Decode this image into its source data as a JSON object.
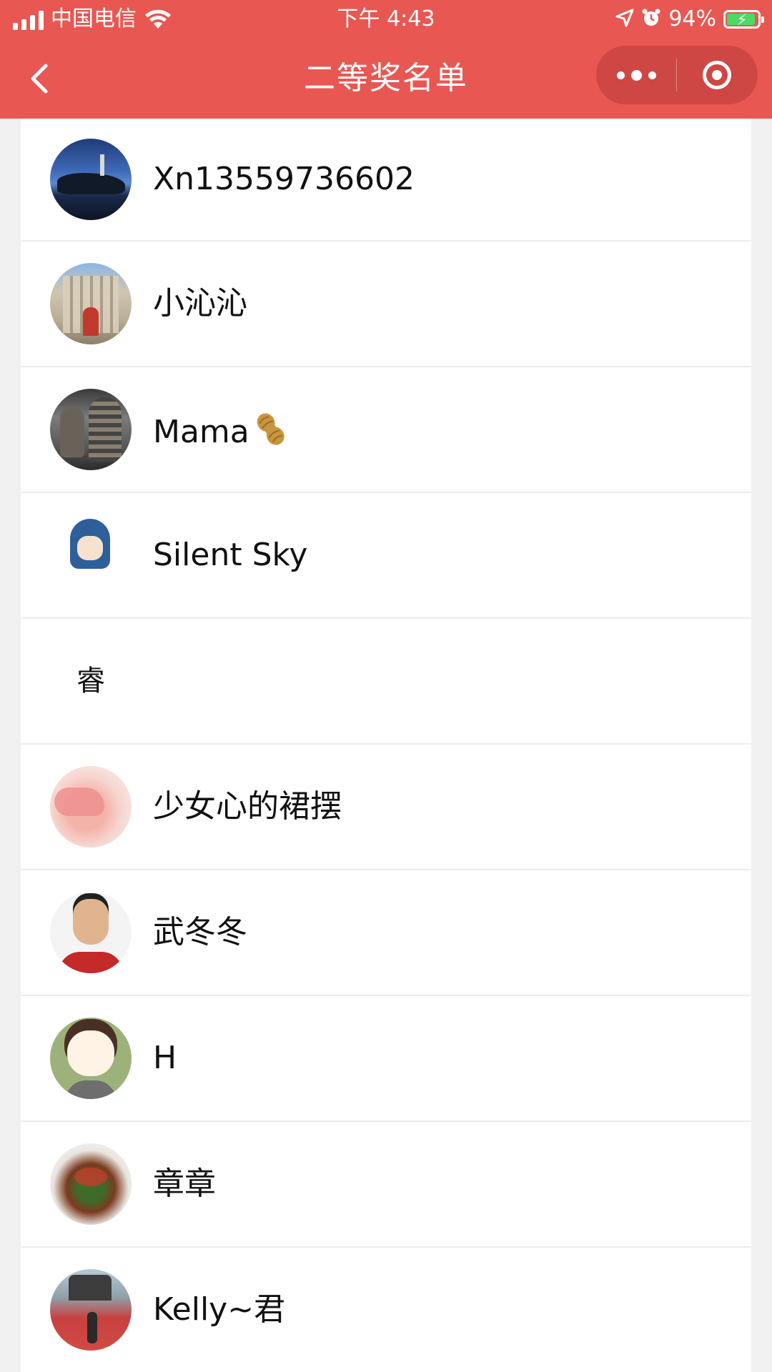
{
  "status_bar": {
    "carrier": "中国电信",
    "time": "下午 4:43",
    "battery_percent": "94%",
    "battery_level": 0.94,
    "icons": [
      "signal-icon",
      "wifi-icon",
      "location-icon",
      "alarm-icon",
      "battery-charging-icon"
    ]
  },
  "nav": {
    "title": "二等奖名单",
    "back_icon": "chevron-left-icon",
    "more_icon": "more-dots-icon",
    "close_icon": "target-close-icon",
    "bar_color": "#e95752"
  },
  "winners": [
    {
      "name": "Xn13559736602",
      "avatar": "photo"
    },
    {
      "name": "小沁沁",
      "avatar": "photo"
    },
    {
      "name": "Mama",
      "avatar": "photo",
      "suffix_icon": "peanut-emoji"
    },
    {
      "name": "Silent Sky",
      "avatar": "cartoon"
    },
    {
      "name": "",
      "avatar": "text",
      "avatar_text": "睿"
    },
    {
      "name": "少女心的裙摆",
      "avatar": "illustration"
    },
    {
      "name": "武冬冬",
      "avatar": "photo"
    },
    {
      "name": "H",
      "avatar": "cartoon"
    },
    {
      "name": "章章",
      "avatar": "photo"
    },
    {
      "name": "Kelly~君",
      "avatar": "photo"
    }
  ]
}
